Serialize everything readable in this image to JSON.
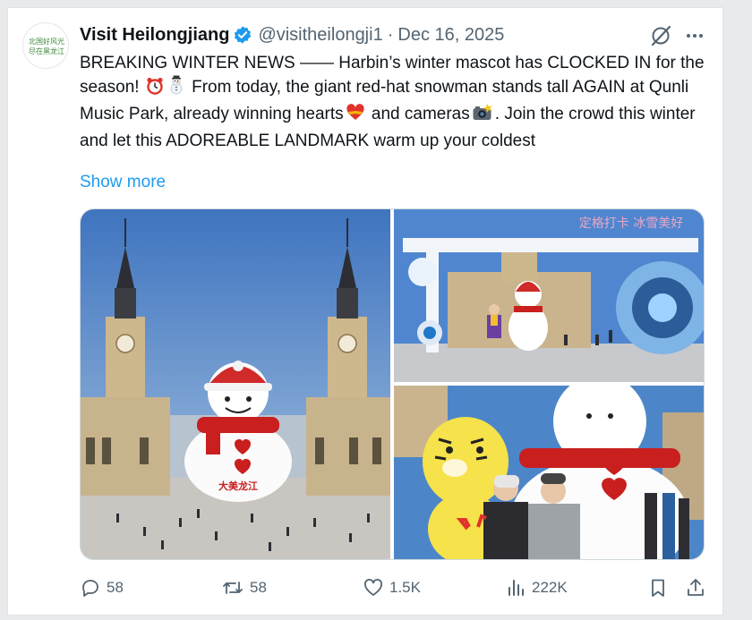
{
  "tweet": {
    "avatar_text": "北国好风光 尽在黑龙江",
    "author_name": "Visit Heilongjiang",
    "handle": "@visitheilongji1",
    "separator": "·",
    "date": "Dec 16, 2025",
    "text": {
      "part1": "BREAKING WINTER NEWS —— Harbin’s winter mascot has CLOCKED IN for the season! ",
      "part2": " From today, the giant red-hat snowman stands tall AGAIN at Qunli Music Park, already winning hearts",
      "part3": " and cameras",
      "part4": ". Join the crowd this winter and let this ADOREABLE LANDMARK warm up your coldest"
    },
    "show_more": "Show more",
    "sign_text": "大美龙江",
    "photo2_sign": "定格打卡 冰雪美好"
  },
  "actions": {
    "replies": "58",
    "reposts": "58",
    "likes": "1.5K",
    "views": "222K"
  },
  "icons": [
    "verified-badge-icon",
    "grok-icon",
    "more-icon",
    "alarm-clock-icon",
    "snowman-icon",
    "heart-ribbon-icon",
    "camera-flash-icon",
    "reply-icon",
    "repost-icon",
    "like-icon",
    "views-icon",
    "bookmark-icon",
    "share-icon"
  ],
  "colors": {
    "accent": "#1d9bf0",
    "text": "#0f1419",
    "secondary": "#536471"
  }
}
